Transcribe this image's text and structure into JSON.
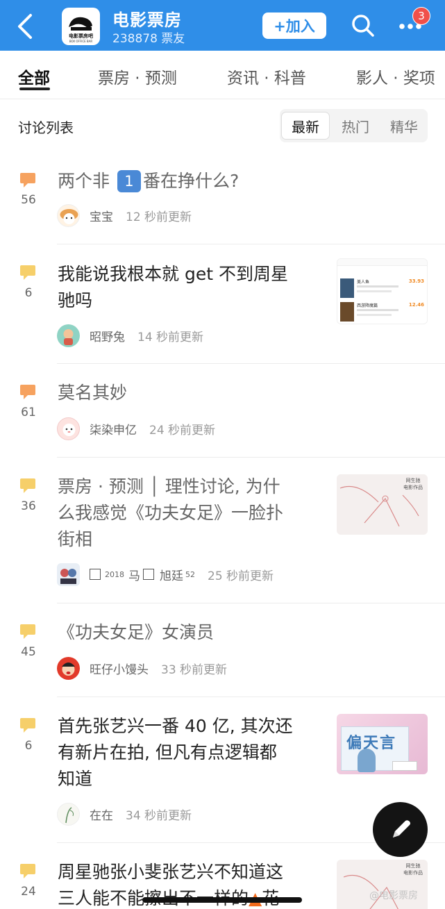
{
  "header": {
    "back_icon": "chevron-left-icon",
    "logo_text": "电影票房吧",
    "bar_name": "电影票房",
    "members": "238878 票友",
    "join_label": "+加入",
    "badge_count": "3",
    "colors": {
      "bar": "#2f8ee8",
      "badge": "#f0504a"
    }
  },
  "tabs": [
    "全部",
    "票房 · 预测",
    "资讯 · 科普",
    "影人 · 奖项"
  ],
  "list": {
    "title": "讨论列表",
    "sort": [
      "最新",
      "热门",
      "精华"
    ]
  },
  "posts": [
    {
      "count": "56",
      "title": "两个非 1 番在挣什么?",
      "title_parts": [
        "两个非 ",
        "1",
        "番在挣什么?"
      ],
      "user": "宝宝",
      "time": "12 秒前更新"
    },
    {
      "count": "6",
      "title_lines": [
        "我能说我根本就 get 不到周星",
        "驰吗"
      ],
      "user": "昭野兔",
      "time": "14 秒前更新",
      "thumb": {
        "rows": [
          {
            "name": "美人鱼",
            "value": "33.93"
          },
          {
            "name": "西游降魔篇",
            "value": "12.46"
          }
        ]
      }
    },
    {
      "count": "61",
      "title": "莫名其妙",
      "user": "柒染申亿",
      "time": "24 秒前更新"
    },
    {
      "count": "36",
      "title_lines": [
        "票房 · 预测 │ 理性讨论, 为什",
        "么我感觉《功夫女足》一脸扑",
        "街相"
      ],
      "user_parts": [
        "2018",
        "马",
        "旭廷",
        "52"
      ],
      "time": "25 秒前更新",
      "thumb": {
        "caption": "网生驰 电影作品"
      }
    },
    {
      "count": "45",
      "title": "《功夫女足》女演员",
      "user": "旺仔小馒头",
      "time": "33 秒前更新"
    },
    {
      "count": "6",
      "title_lines": [
        "首先张艺兴一番 40 亿, 其次还",
        "有新片在拍, 但凡有点逻辑都",
        "知道"
      ],
      "user": "在在",
      "time": "34 秒前更新"
    },
    {
      "count": "24",
      "title_lines": [
        "周星驰张小斐张艺兴不知道这",
        "三人能不能擦出不一样的",
        "花"
      ],
      "user": "",
      "time": "",
      "thumb": {
        "caption": "网生驰 电影作品"
      }
    }
  ],
  "fab_icon": "pencil-icon",
  "watermark": "@电影票房"
}
